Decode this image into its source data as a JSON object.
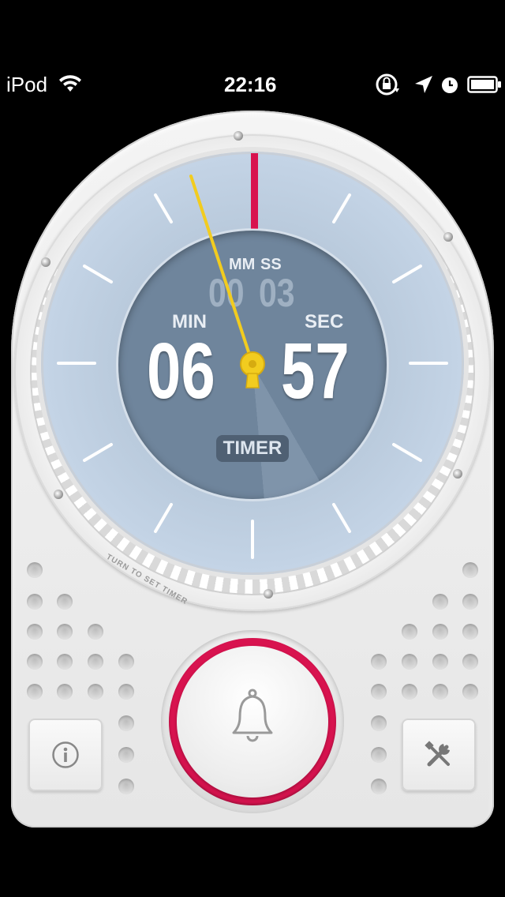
{
  "status_bar": {
    "carrier": "iPod",
    "time": "22:16",
    "icons": [
      "wifi-icon",
      "rotation-lock-icon",
      "location-icon",
      "alarm-clock-icon",
      "battery-icon"
    ]
  },
  "timer": {
    "mm_label": "MM",
    "ss_label": "SS",
    "mm_value": "00",
    "ss_value": "03",
    "min_label": "MIN",
    "sec_label": "SEC",
    "minutes": "06",
    "seconds": "57",
    "mode_label": "TIMER",
    "hint": "TURN TO SET TIMER"
  },
  "controls": {
    "info_icon": "info-icon",
    "main_icon": "bell-icon",
    "settings_icon": "tools-icon"
  },
  "colors": {
    "accent": "#d8134f",
    "hand": "#f2cc1f",
    "dial": "#b7c8da",
    "inner_dial": "#6f859c"
  }
}
